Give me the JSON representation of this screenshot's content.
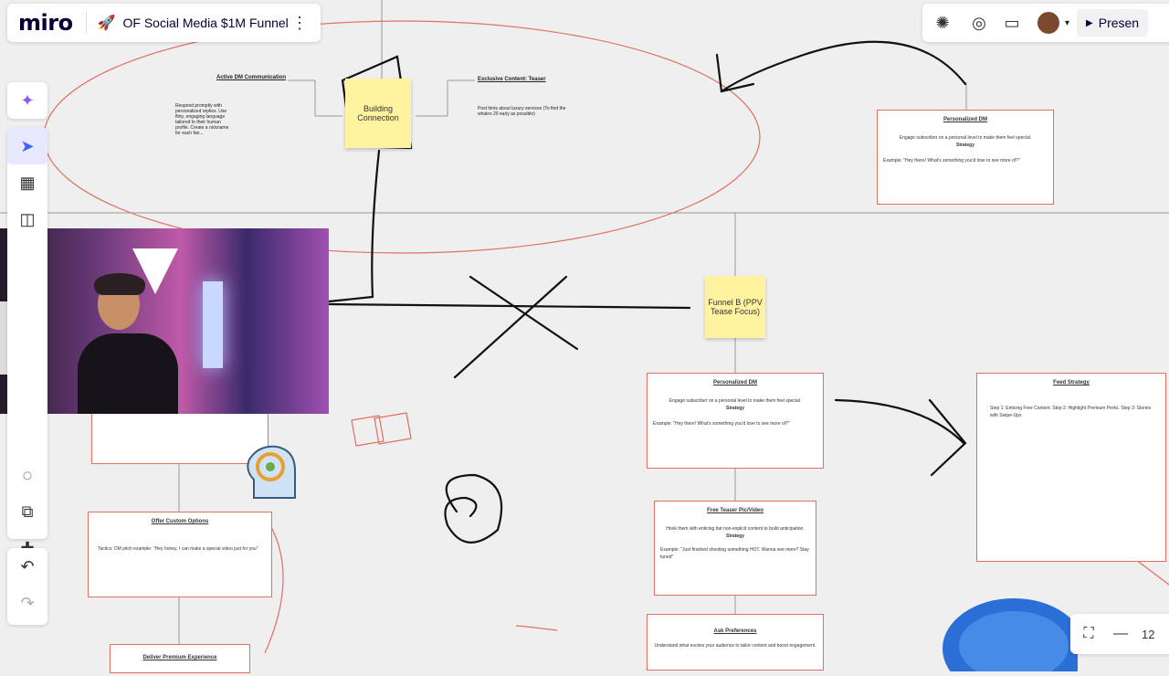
{
  "app": {
    "logo": "miro",
    "board_title": "OF Social Media $1M Funnel",
    "present_label": "Presen"
  },
  "zoom": {
    "value": "12"
  },
  "stickies": {
    "building": "Building Connection",
    "funnel_b": "Funnel B (PPV Tease Focus)"
  },
  "cards": {
    "active_dm": {
      "title": "Active DM Communication",
      "body": "Respond promptly with personalized replies. Use flirty, engaging language tailored to their human profile. Create a nickname for each fan..."
    },
    "exclusive": {
      "title": "Exclusive Content: Teaser",
      "body": "Post hints about luxury services (To find the whales 20 early as possible)"
    },
    "personalized_top": {
      "title": "Personalized DM",
      "body": "Engage subscriber on a personal level to make them feel special.",
      "strategy": "Strategy",
      "example": "Example: \"Hey there! What's something you'd love to see more of?\""
    },
    "personalized_mid": {
      "title": "Personalized DM",
      "body": "Engage subscriber on a personal level to make them feel special.",
      "strategy": "Strategy",
      "example": "Example: \"Hey there! What's something you'd love to see more of?\""
    },
    "free_teaser": {
      "title": "Free Teaser Pic/Video",
      "body": "Hook them with enticing but non-explicit content to build anticipation.",
      "strategy": "Strategy",
      "example": "Example: \"Just finished shooting something HOT. Wanna see more? Stay tuned\""
    },
    "ask_prefs": {
      "title": "Ask Preferences",
      "body": "Understand what excites your audience to tailor content and boost engagement."
    },
    "custom_opts": {
      "title": "Offer Custom Options",
      "body": "Tactics: DM pitch example: \"Hey honey, I can make a special video just for you\""
    },
    "feed_strategy": {
      "title": "Feed Strategy",
      "body": "Step 1: Enticing Free Content. Step 2: Highlight Premium Perks. Step 3: Stories with Swipe-Ups"
    },
    "deliver": {
      "title": "Deliver Premium Experience"
    }
  }
}
